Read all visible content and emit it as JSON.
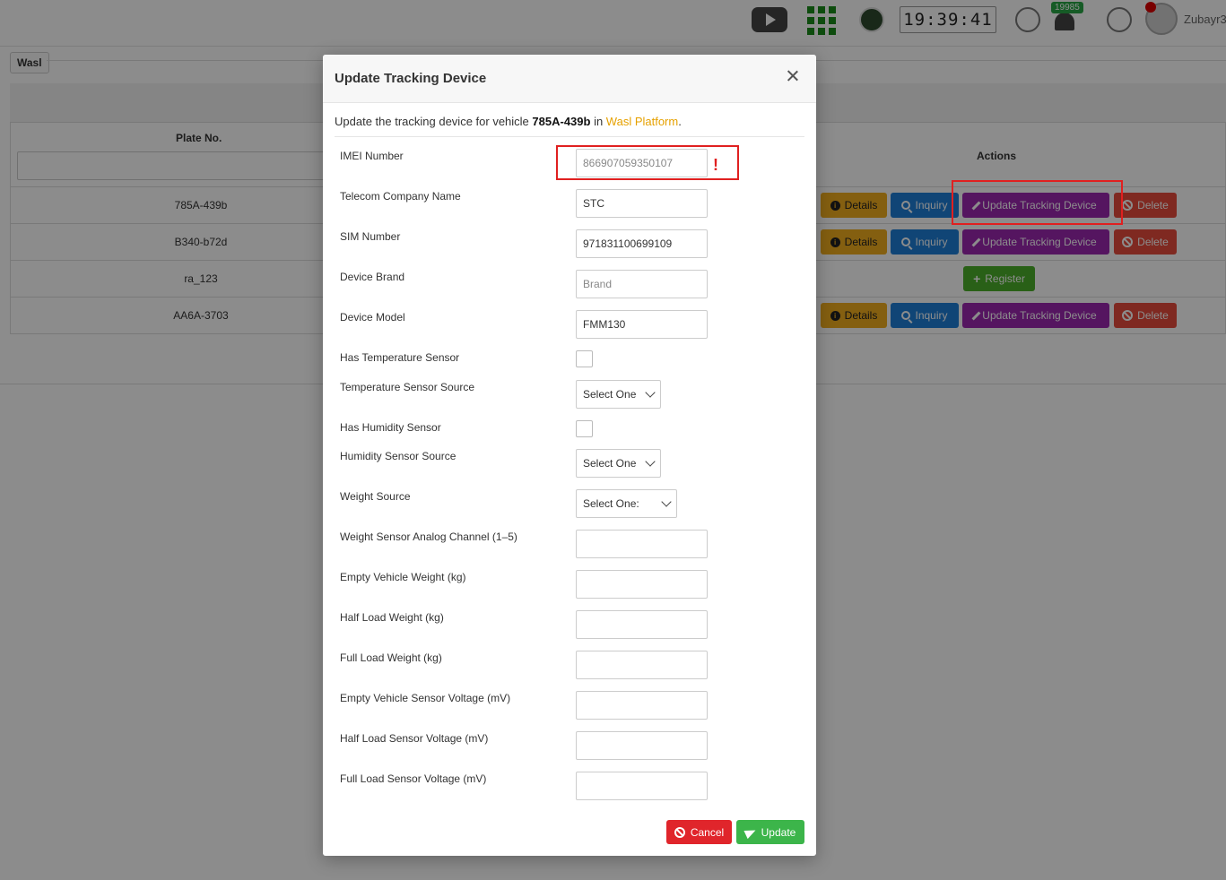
{
  "topbar": {
    "clock": "19:39:41",
    "notification_count": "19985",
    "username": "Zubayr3"
  },
  "page": {
    "tab_label": "Wasl",
    "columns": {
      "plate": "Plate No.",
      "actions": "Actions"
    },
    "rows": [
      {
        "plate": "785A-439b"
      },
      {
        "plate": "B340-b72d"
      },
      {
        "plate": "ra_123"
      },
      {
        "plate": "AA6A-3703"
      }
    ],
    "buttons": {
      "details": "Details",
      "inquiry": "Inquiry",
      "update": "Update Tracking Device",
      "delete": "Delete",
      "register": "Register"
    }
  },
  "modal": {
    "title": "Update Tracking Device",
    "desc_prefix": "Update the tracking device for vehicle ",
    "vehicle": "785A-439b",
    "desc_mid": " in ",
    "platform": "Wasl Platform",
    "desc_suffix": ".",
    "fields": {
      "imei": {
        "label": "IMEI Number",
        "value": "866907059350107"
      },
      "telecom": {
        "label": "Telecom Company Name",
        "value": "STC"
      },
      "sim": {
        "label": "SIM Number",
        "value": "971831100699109"
      },
      "brand": {
        "label": "Device Brand",
        "value": "Brand"
      },
      "model": {
        "label": "Device Model",
        "value": "FMM130"
      },
      "has_temp": {
        "label": "Has Temperature Sensor"
      },
      "temp_source": {
        "label": "Temperature Sensor Source",
        "value": "Select One"
      },
      "has_humidity": {
        "label": "Has Humidity Sensor"
      },
      "humidity_source": {
        "label": "Humidity Sensor Source",
        "value": "Select One"
      },
      "weight_source": {
        "label": "Weight Source",
        "value": "Select One:"
      },
      "analog_channel": {
        "label": "Weight Sensor Analog Channel (1–5)",
        "value": ""
      },
      "empty_weight": {
        "label": "Empty Vehicle Weight (kg)",
        "value": ""
      },
      "half_weight": {
        "label": "Half Load Weight (kg)",
        "value": ""
      },
      "full_weight": {
        "label": "Full Load Weight (kg)",
        "value": ""
      },
      "empty_voltage": {
        "label": "Empty Vehicle Sensor Voltage (mV)",
        "value": ""
      },
      "half_voltage": {
        "label": "Half Load Sensor Voltage (mV)",
        "value": ""
      },
      "full_voltage": {
        "label": "Full Load Sensor Voltage (mV)",
        "value": ""
      }
    },
    "warning_mark": "!",
    "cancel_label": "Cancel",
    "update_label": "Update"
  }
}
